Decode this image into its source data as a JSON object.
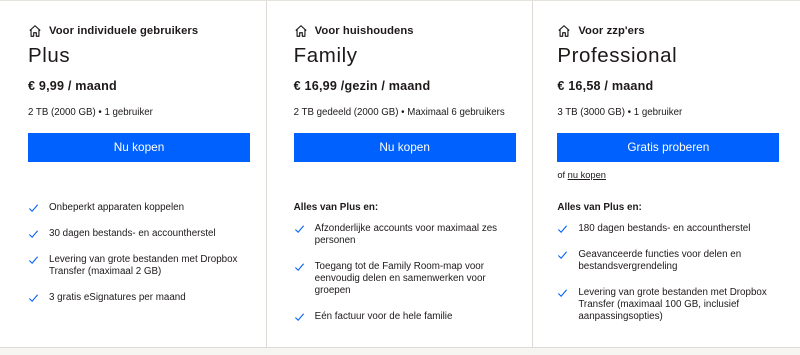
{
  "accent_color": "#0061fe",
  "plans": [
    {
      "audience": "Voor individuele gebruikers",
      "name": "Plus",
      "price": "€ 9,99 / maand",
      "storage": "2 TB (2000 GB) • 1 gebruiker",
      "cta": "Nu kopen",
      "alt_prefix": "",
      "alt_link": "",
      "includes_heading": "",
      "features": [
        "Onbeperkt apparaten koppelen",
        "30 dagen bestands- en accountherstel",
        "Levering van grote bestanden met Dropbox Transfer (maximaal 2 GB)",
        "3 gratis eSignatures per maand"
      ]
    },
    {
      "audience": "Voor huishoudens",
      "name": "Family",
      "price": "€ 16,99 /gezin / maand",
      "storage": "2 TB gedeeld (2000 GB) • Maximaal 6 gebruikers",
      "cta": "Nu kopen",
      "alt_prefix": "",
      "alt_link": "",
      "includes_heading": "Alles van Plus en:",
      "features": [
        "Afzonderlijke accounts voor maximaal zes personen",
        "Toegang tot de Family Room-map voor eenvoudig delen en samenwerken voor groepen",
        "Eén factuur voor de hele familie"
      ]
    },
    {
      "audience": "Voor zzp'ers",
      "name": "Professional",
      "price": "€ 16,58 / maand",
      "storage": "3 TB (3000 GB) • 1 gebruiker",
      "cta": "Gratis proberen",
      "alt_prefix": "of",
      "alt_link": "nu kopen",
      "includes_heading": "Alles van Plus en:",
      "features": [
        "180 dagen bestands- en accountherstel",
        "Geavanceerde functies voor delen en bestandsvergrendeling",
        "Levering van grote bestanden met Dropbox Transfer (maximaal 100 GB, inclusief aanpassingsopties)"
      ]
    }
  ]
}
